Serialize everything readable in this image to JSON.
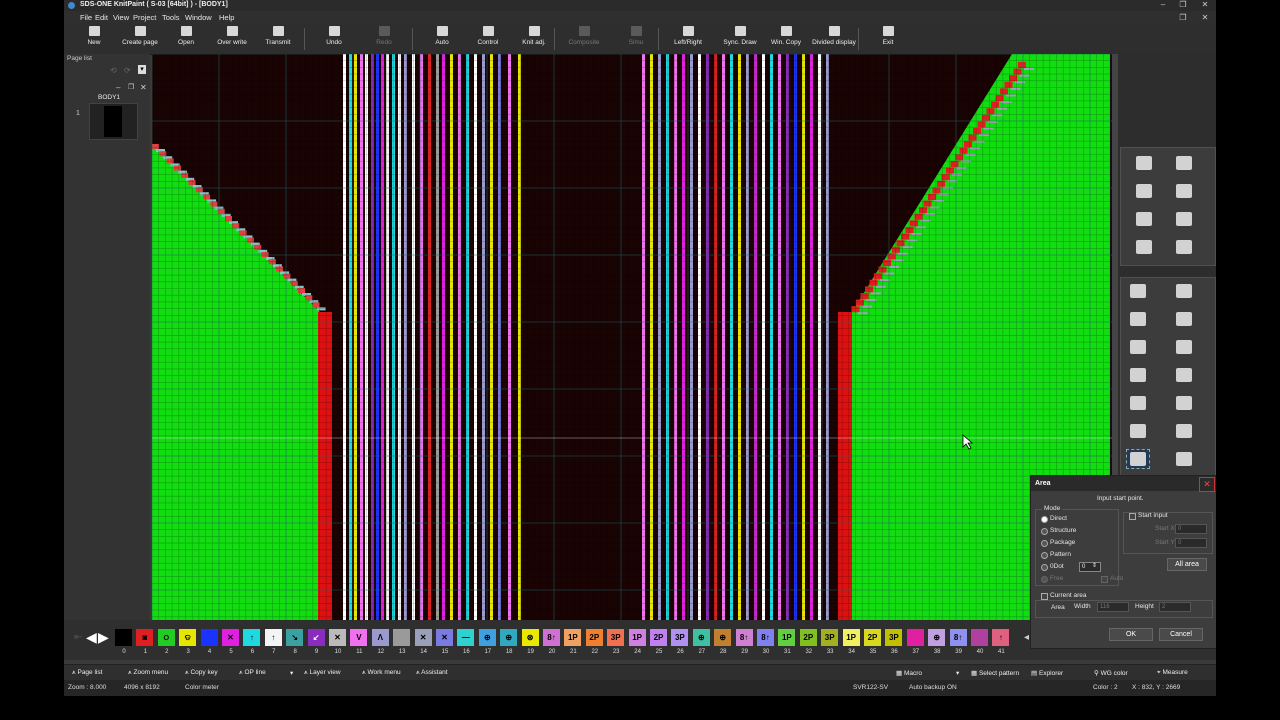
{
  "window": {
    "title": "SDS-ONE KnitPaint ( S-03 [64bit] ) - [BODY1]",
    "controls": [
      "–",
      "❐",
      "✕"
    ]
  },
  "menu": [
    "File",
    "Edit",
    "View",
    "Project",
    "Tools",
    "Window",
    "Help"
  ],
  "toolbar": [
    {
      "label": "New",
      "enabled": true
    },
    {
      "label": "Create page",
      "enabled": true
    },
    {
      "label": "Open",
      "enabled": true
    },
    {
      "label": "Over write",
      "enabled": true
    },
    {
      "label": "Transmit",
      "enabled": true
    },
    {
      "label": "Undo",
      "enabled": true
    },
    {
      "label": "Redo",
      "enabled": false
    },
    {
      "label": "Auto",
      "enabled": true
    },
    {
      "label": "Control",
      "enabled": true
    },
    {
      "label": "Knit adj.",
      "enabled": true
    },
    {
      "label": "Composite",
      "enabled": false
    },
    {
      "label": "Simu",
      "enabled": false
    },
    {
      "label": "Left/Right",
      "enabled": true
    },
    {
      "label": "Sync. Draw",
      "enabled": true
    },
    {
      "label": "Win. Copy",
      "enabled": true
    },
    {
      "label": "Divided display",
      "enabled": true
    },
    {
      "label": "Exit",
      "enabled": true
    }
  ],
  "page_list": {
    "header": "Page list",
    "pages": [
      {
        "number": "1",
        "name": "BODY1"
      }
    ]
  },
  "canvas": {
    "background_color": "#1a0303",
    "body_color": "#11dd11",
    "rib_color": "#dd1111"
  },
  "palette": [
    {
      "num": "0",
      "color": "#000000",
      "glyph": ""
    },
    {
      "num": "1",
      "color": "#e02020",
      "glyph": "◙"
    },
    {
      "num": "2",
      "color": "#22cc22",
      "glyph": "ଠ"
    },
    {
      "num": "3",
      "color": "#e6e600",
      "glyph": "ଡ"
    },
    {
      "num": "4",
      "color": "#1a33ff",
      "glyph": ""
    },
    {
      "num": "5",
      "color": "#e020e0",
      "glyph": "✕"
    },
    {
      "num": "6",
      "color": "#20d8e0",
      "glyph": "↑"
    },
    {
      "num": "7",
      "color": "#f4f4f4",
      "glyph": "↑"
    },
    {
      "num": "8",
      "color": "#3aa0a0",
      "glyph": "↘"
    },
    {
      "num": "9",
      "color": "#8a2cc0",
      "glyph": "↙"
    },
    {
      "num": "10",
      "color": "#bbbbbb",
      "glyph": "✕"
    },
    {
      "num": "11",
      "color": "#f070f0",
      "glyph": "V"
    },
    {
      "num": "12",
      "color": "#9a9ad0",
      "glyph": "Λ"
    },
    {
      "num": "13",
      "color": "#9a9a9a",
      "glyph": ""
    },
    {
      "num": "14",
      "color": "#9aa0b8",
      "glyph": "✕"
    },
    {
      "num": "15",
      "color": "#7a7ae0",
      "glyph": "✕"
    },
    {
      "num": "16",
      "color": "#30d0d0",
      "glyph": "—"
    },
    {
      "num": "17",
      "color": "#3fa0e0",
      "glyph": "⊕"
    },
    {
      "num": "18",
      "color": "#30a8c0",
      "glyph": "⊕"
    },
    {
      "num": "19",
      "color": "#e8e800",
      "glyph": "⊛"
    },
    {
      "num": "20",
      "color": "#d070d0",
      "glyph": "8↑"
    },
    {
      "num": "21",
      "color": "#f0a060",
      "glyph": "1P"
    },
    {
      "num": "22",
      "color": "#f08030",
      "glyph": "2P"
    },
    {
      "num": "23",
      "color": "#f07050",
      "glyph": "3P"
    },
    {
      "num": "24",
      "color": "#d080e0",
      "glyph": "1P"
    },
    {
      "num": "25",
      "color": "#c080f0",
      "glyph": "2P"
    },
    {
      "num": "26",
      "color": "#b090f0",
      "glyph": "3P"
    },
    {
      "num": "27",
      "color": "#40c0a0",
      "glyph": "⊕"
    },
    {
      "num": "28",
      "color": "#c08030",
      "glyph": "⊕"
    },
    {
      "num": "29",
      "color": "#d080d0",
      "glyph": "8↑"
    },
    {
      "num": "30",
      "color": "#8080f0",
      "glyph": "8↑"
    },
    {
      "num": "31",
      "color": "#60d040",
      "glyph": "1P"
    },
    {
      "num": "32",
      "color": "#80c020",
      "glyph": "2P"
    },
    {
      "num": "33",
      "color": "#a0b020",
      "glyph": "3P"
    },
    {
      "num": "34",
      "color": "#f0f060",
      "glyph": "1P"
    },
    {
      "num": "35",
      "color": "#d8d820",
      "glyph": "2P"
    },
    {
      "num": "36",
      "color": "#c0c000",
      "glyph": "3P"
    },
    {
      "num": "37",
      "color": "#e020a0",
      "glyph": ""
    },
    {
      "num": "38",
      "color": "#c0a0e0",
      "glyph": "⊕"
    },
    {
      "num": "39",
      "color": "#9090f0",
      "glyph": "8↑"
    },
    {
      "num": "40",
      "color": "#b040a0",
      "glyph": ""
    },
    {
      "num": "41",
      "color": "#e06080",
      "glyph": "↑"
    }
  ],
  "statusbar": {
    "left": [
      "Page list",
      "Zoom menu",
      "Copy key",
      "OP line",
      "Layer view",
      "Work menu",
      "Assistant"
    ],
    "right": [
      "Macro",
      "Select pattern",
      "Explorer",
      "WG color",
      "Measure"
    ]
  },
  "info": {
    "zoom": "Zoom : 8.000",
    "size": "4096 x 8192",
    "color_meter": "Color meter",
    "machine": "SVR122-SV",
    "backup": "Auto backup ON",
    "color": "Color : 2",
    "coords": "X : 832, Y : 2669"
  },
  "dialog": {
    "title": "Area",
    "prompt": "Input start point.",
    "mode_label": "Mode",
    "modes": [
      {
        "label": "Direct",
        "selected": true,
        "enabled": true
      },
      {
        "label": "Structure",
        "selected": false,
        "enabled": true
      },
      {
        "label": "Package",
        "selected": false,
        "enabled": true
      },
      {
        "label": "Pattern",
        "selected": false,
        "enabled": true
      },
      {
        "label": "0Dot",
        "selected": false,
        "enabled": true
      },
      {
        "label": "Free",
        "selected": false,
        "enabled": false
      }
    ],
    "dot_value": "0",
    "auto_label": "Auto",
    "start_input_label": "Start input",
    "start_x_label": "Start X",
    "start_x_value": "0",
    "start_y_label": "Start Y",
    "start_y_value": "0",
    "all_area_label": "All area",
    "current_area_label": "Current area",
    "area_label": "Area",
    "width_label": "Width",
    "width_value": "116",
    "height_label": "Height",
    "height_value": "2",
    "ok_label": "OK",
    "cancel_label": "Cancel"
  }
}
